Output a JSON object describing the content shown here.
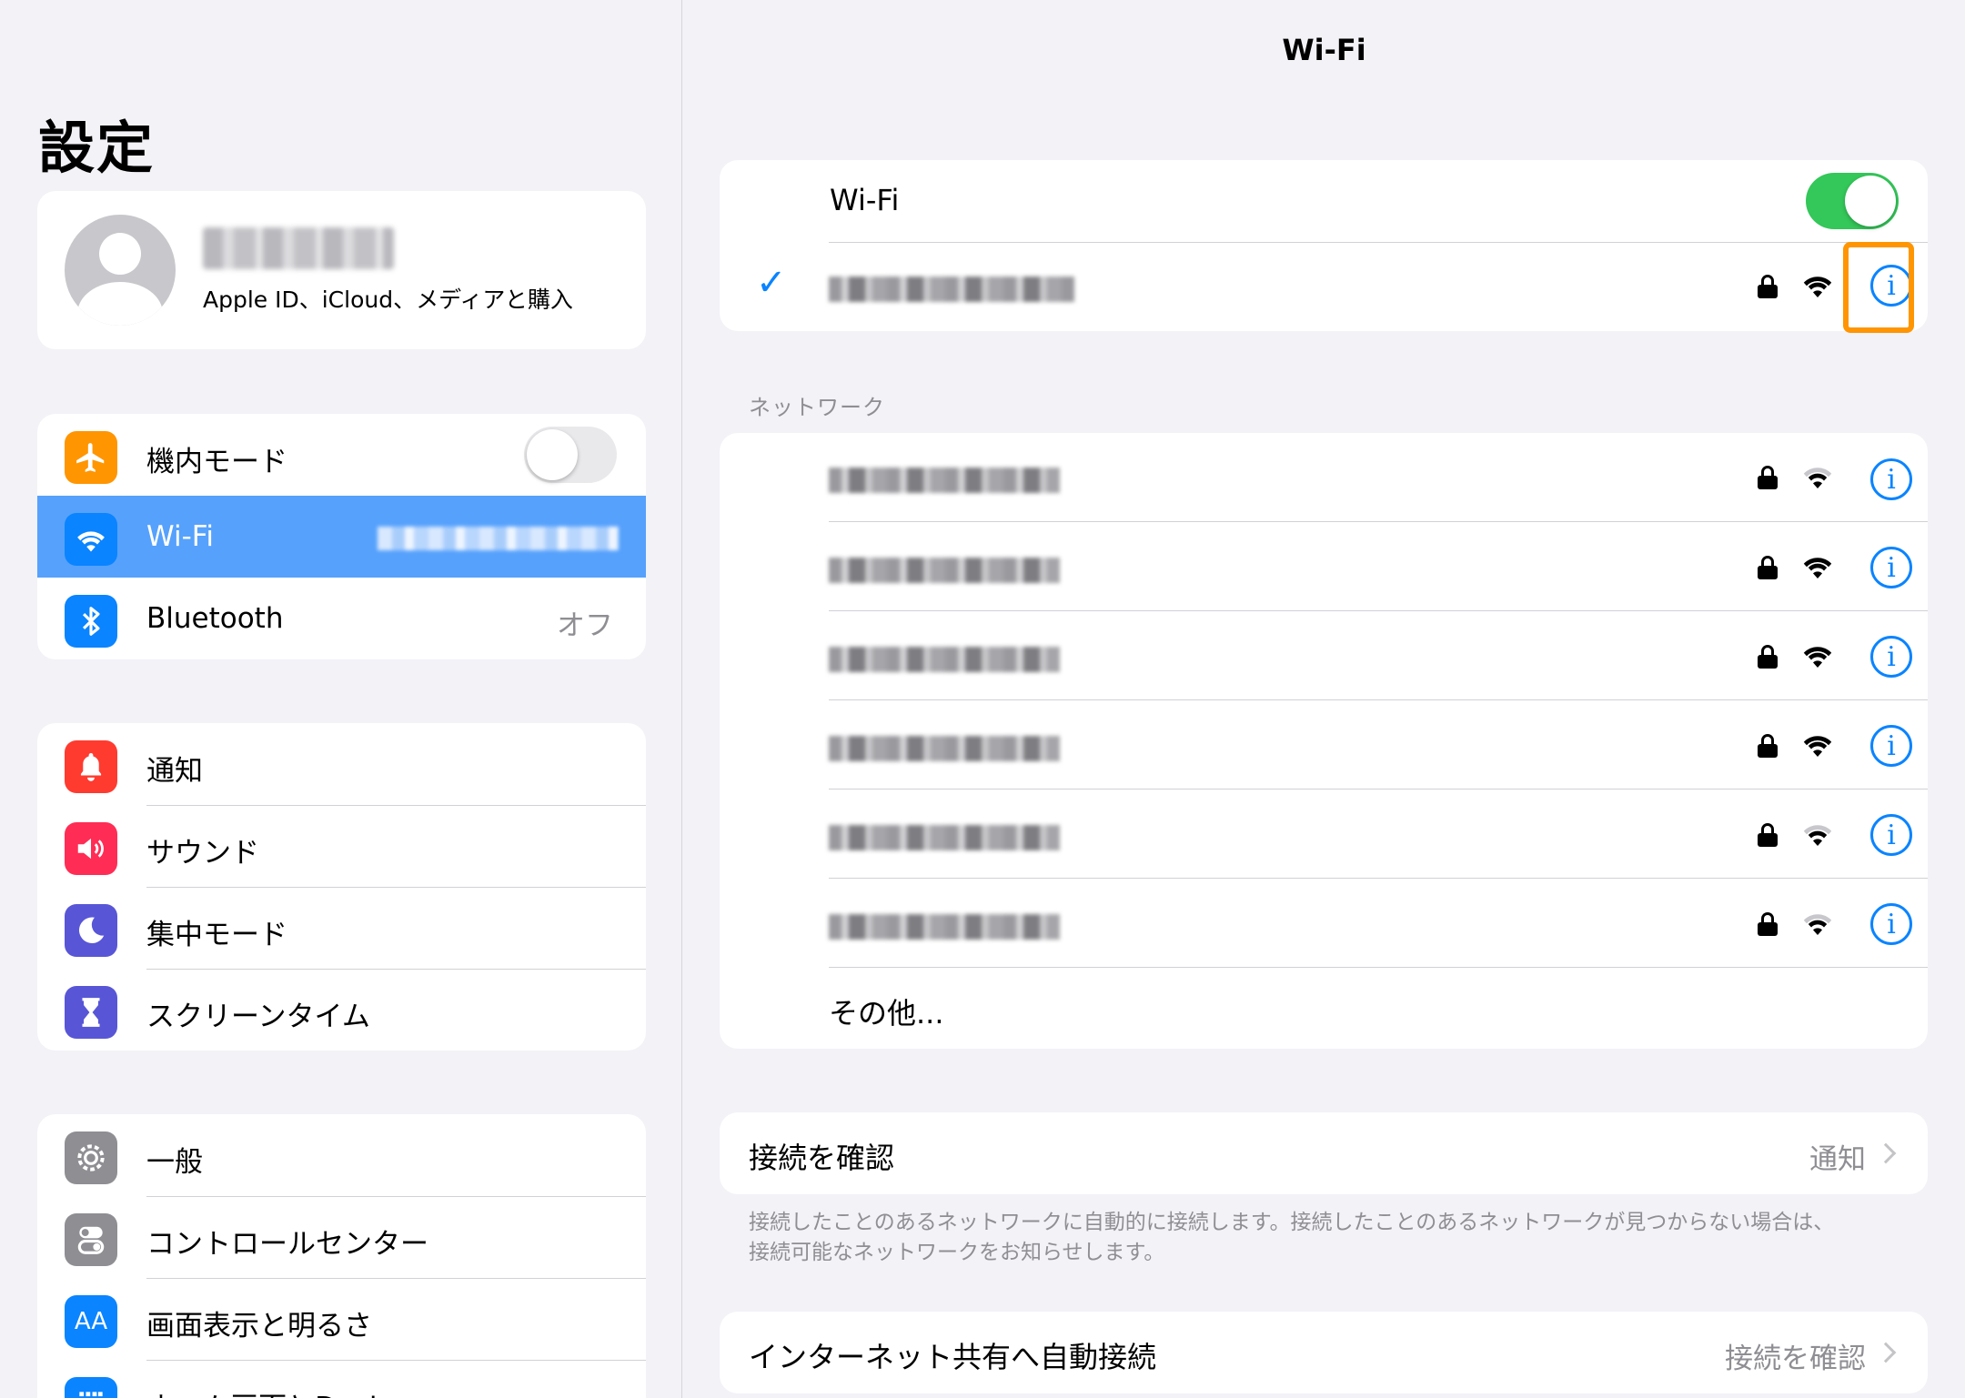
{
  "sidebar": {
    "title": "設定",
    "profile": {
      "subtitle": "Apple ID、iCloud、メディアと購入"
    },
    "group1": [
      {
        "label": "機内モード",
        "icon": "airplane-icon",
        "color": "#ff9500"
      },
      {
        "label": "Wi-Fi",
        "icon": "wifi-icon",
        "color": "#0a84ff"
      },
      {
        "label": "Bluetooth",
        "icon": "bluetooth-icon",
        "color": "#0a84ff",
        "value": "オフ"
      }
    ],
    "group2": [
      {
        "label": "通知",
        "icon": "bell-icon",
        "color": "#ff3b30"
      },
      {
        "label": "サウンド",
        "icon": "speaker-icon",
        "color": "#ff2d55"
      },
      {
        "label": "集中モード",
        "icon": "moon-icon",
        "color": "#5856d6"
      },
      {
        "label": "スクリーンタイム",
        "icon": "hourglass-icon",
        "color": "#5856d6"
      }
    ],
    "group3": [
      {
        "label": "一般",
        "icon": "gear-icon",
        "color": "#8e8e93"
      },
      {
        "label": "コントロールセンター",
        "icon": "switches-icon",
        "color": "#8e8e93"
      },
      {
        "label": "画面表示と明るさ",
        "icon": "text-size-icon",
        "color": "#0a84ff",
        "icon_text": "AA"
      },
      {
        "label": "ホーム画面とDock",
        "icon": "home-grid-icon",
        "color": "#0a84ff"
      }
    ],
    "airplane_toggle": "off"
  },
  "main": {
    "title": "Wi-Fi",
    "wifi_label": "Wi-Fi",
    "wifi_toggle": "on",
    "networks_header": "ネットワーク",
    "network_count": 6,
    "other_label": "その他...",
    "ask_join_label": "接続を確認",
    "ask_join_value": "通知",
    "ask_join_note_line1": "接続したことのあるネットワークに自動的に接続します。接続したことのあるネットワークが見つからない場合は、",
    "ask_join_note_line2": "接続可能なネットワークをお知らせします。",
    "hotspot_label": "インターネット共有へ自動接続",
    "hotspot_value": "接続を確認",
    "info_glyph": "i",
    "check_glyph": "✓",
    "highlight_color": "#ff9500"
  }
}
